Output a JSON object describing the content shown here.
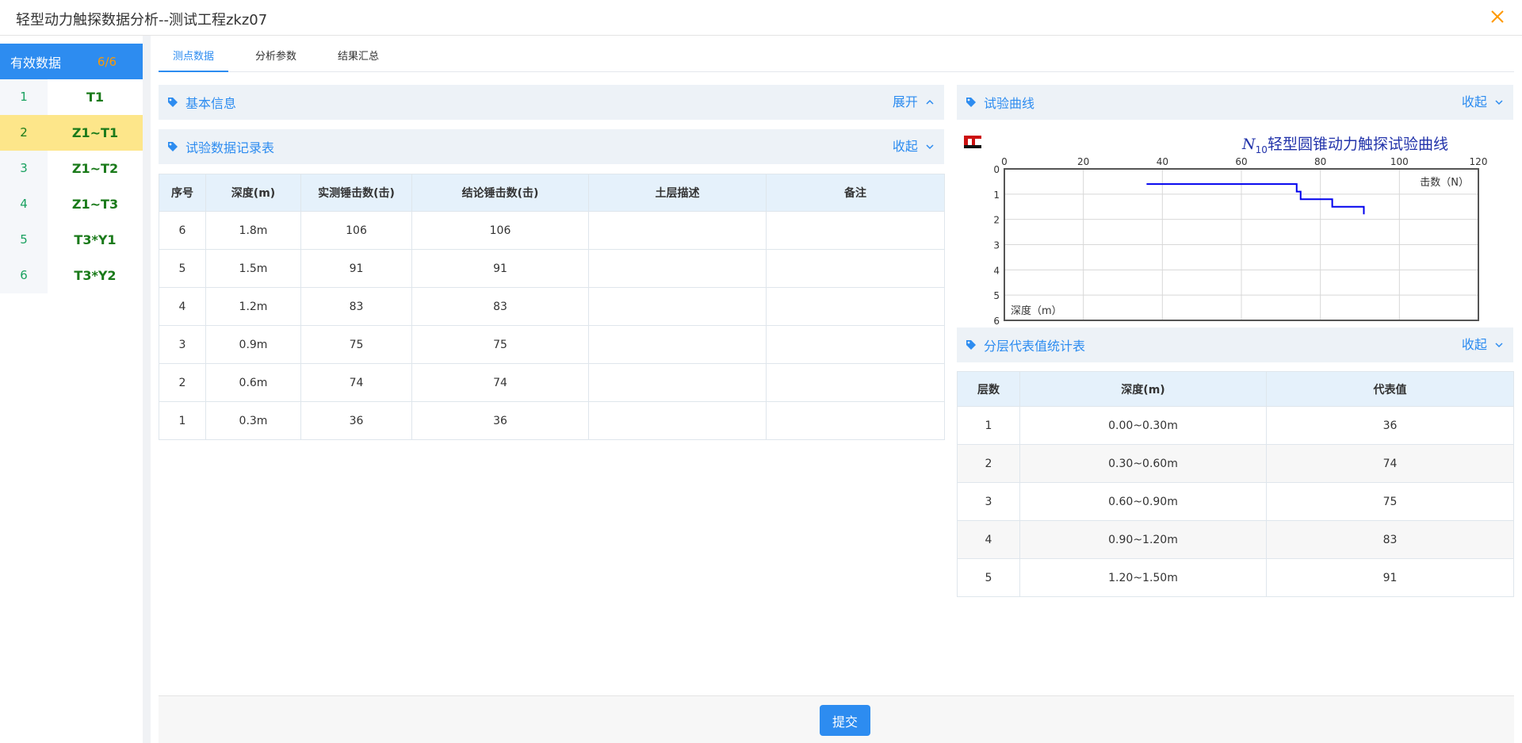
{
  "window": {
    "title": "轻型动力触探数据分析--测试工程zkz07"
  },
  "sidebar": {
    "header_label": "有效数据",
    "header_count": "6/6",
    "items": [
      {
        "num": "1",
        "name": "T1"
      },
      {
        "num": "2",
        "name": "Z1~T1"
      },
      {
        "num": "3",
        "name": "Z1~T2"
      },
      {
        "num": "4",
        "name": "Z1~T3"
      },
      {
        "num": "5",
        "name": "T3*Y1"
      },
      {
        "num": "6",
        "name": "T3*Y2"
      }
    ]
  },
  "tabs": [
    {
      "label": "测点数据"
    },
    {
      "label": "分析参数"
    },
    {
      "label": "结果汇总"
    }
  ],
  "panels": {
    "basic_info": {
      "title": "基本信息",
      "toggle": "展开"
    },
    "record_table": {
      "title": "试验数据记录表",
      "toggle": "收起"
    },
    "test_curve": {
      "title": "试验曲线",
      "toggle": "收起"
    },
    "layer_stats": {
      "title": "分层代表值统计表",
      "toggle": "收起"
    }
  },
  "record_table": {
    "headers": [
      "序号",
      "深度(m)",
      "实测锤击数(击)",
      "结论锤击数(击)",
      "土层描述",
      "备注"
    ],
    "rows": [
      [
        "6",
        "1.8m",
        "106",
        "106",
        "",
        ""
      ],
      [
        "5",
        "1.5m",
        "91",
        "91",
        "",
        ""
      ],
      [
        "4",
        "1.2m",
        "83",
        "83",
        "",
        ""
      ],
      [
        "3",
        "0.9m",
        "75",
        "75",
        "",
        ""
      ],
      [
        "2",
        "0.6m",
        "74",
        "74",
        "",
        ""
      ],
      [
        "1",
        "0.3m",
        "36",
        "36",
        "",
        ""
      ]
    ]
  },
  "layer_table": {
    "headers": [
      "层数",
      "深度(m)",
      "代表值"
    ],
    "rows": [
      [
        "1",
        "0.00~0.30m",
        "36"
      ],
      [
        "2",
        "0.30~0.60m",
        "74"
      ],
      [
        "3",
        "0.60~0.90m",
        "75"
      ],
      [
        "4",
        "0.90~1.20m",
        "83"
      ],
      [
        "5",
        "1.20~1.50m",
        "91"
      ]
    ]
  },
  "chart_data": {
    "type": "line",
    "title_prefix": "N",
    "title_sub": "10",
    "title": "轻型圆锥动力触探试验曲线",
    "x_label": "击数（N）",
    "y_label": "深度（m）",
    "x_ticks": [
      "0",
      "20",
      "40",
      "60",
      "80",
      "100",
      "120"
    ],
    "y_ticks": [
      "0",
      "1",
      "2",
      "3",
      "4",
      "5",
      "6"
    ],
    "xlim": [
      0,
      120
    ],
    "ylim": [
      0,
      6
    ],
    "y_inverted": true,
    "grid": true,
    "series": [
      {
        "points": [
          [
            36,
            0.6
          ],
          [
            74,
            0.6
          ],
          [
            74,
            0.9
          ],
          [
            75,
            0.9
          ],
          [
            75,
            1.2
          ],
          [
            83,
            1.2
          ],
          [
            83,
            1.5
          ],
          [
            91,
            1.5
          ],
          [
            91,
            1.8
          ]
        ]
      }
    ],
    "line_color": "#0000ee"
  },
  "footer": {
    "submit_label": "提交"
  },
  "colors": {
    "accent": "#2d8cf0",
    "highlight": "#fde68a",
    "green": "#1a7a1a",
    "count": "#ff9900"
  }
}
